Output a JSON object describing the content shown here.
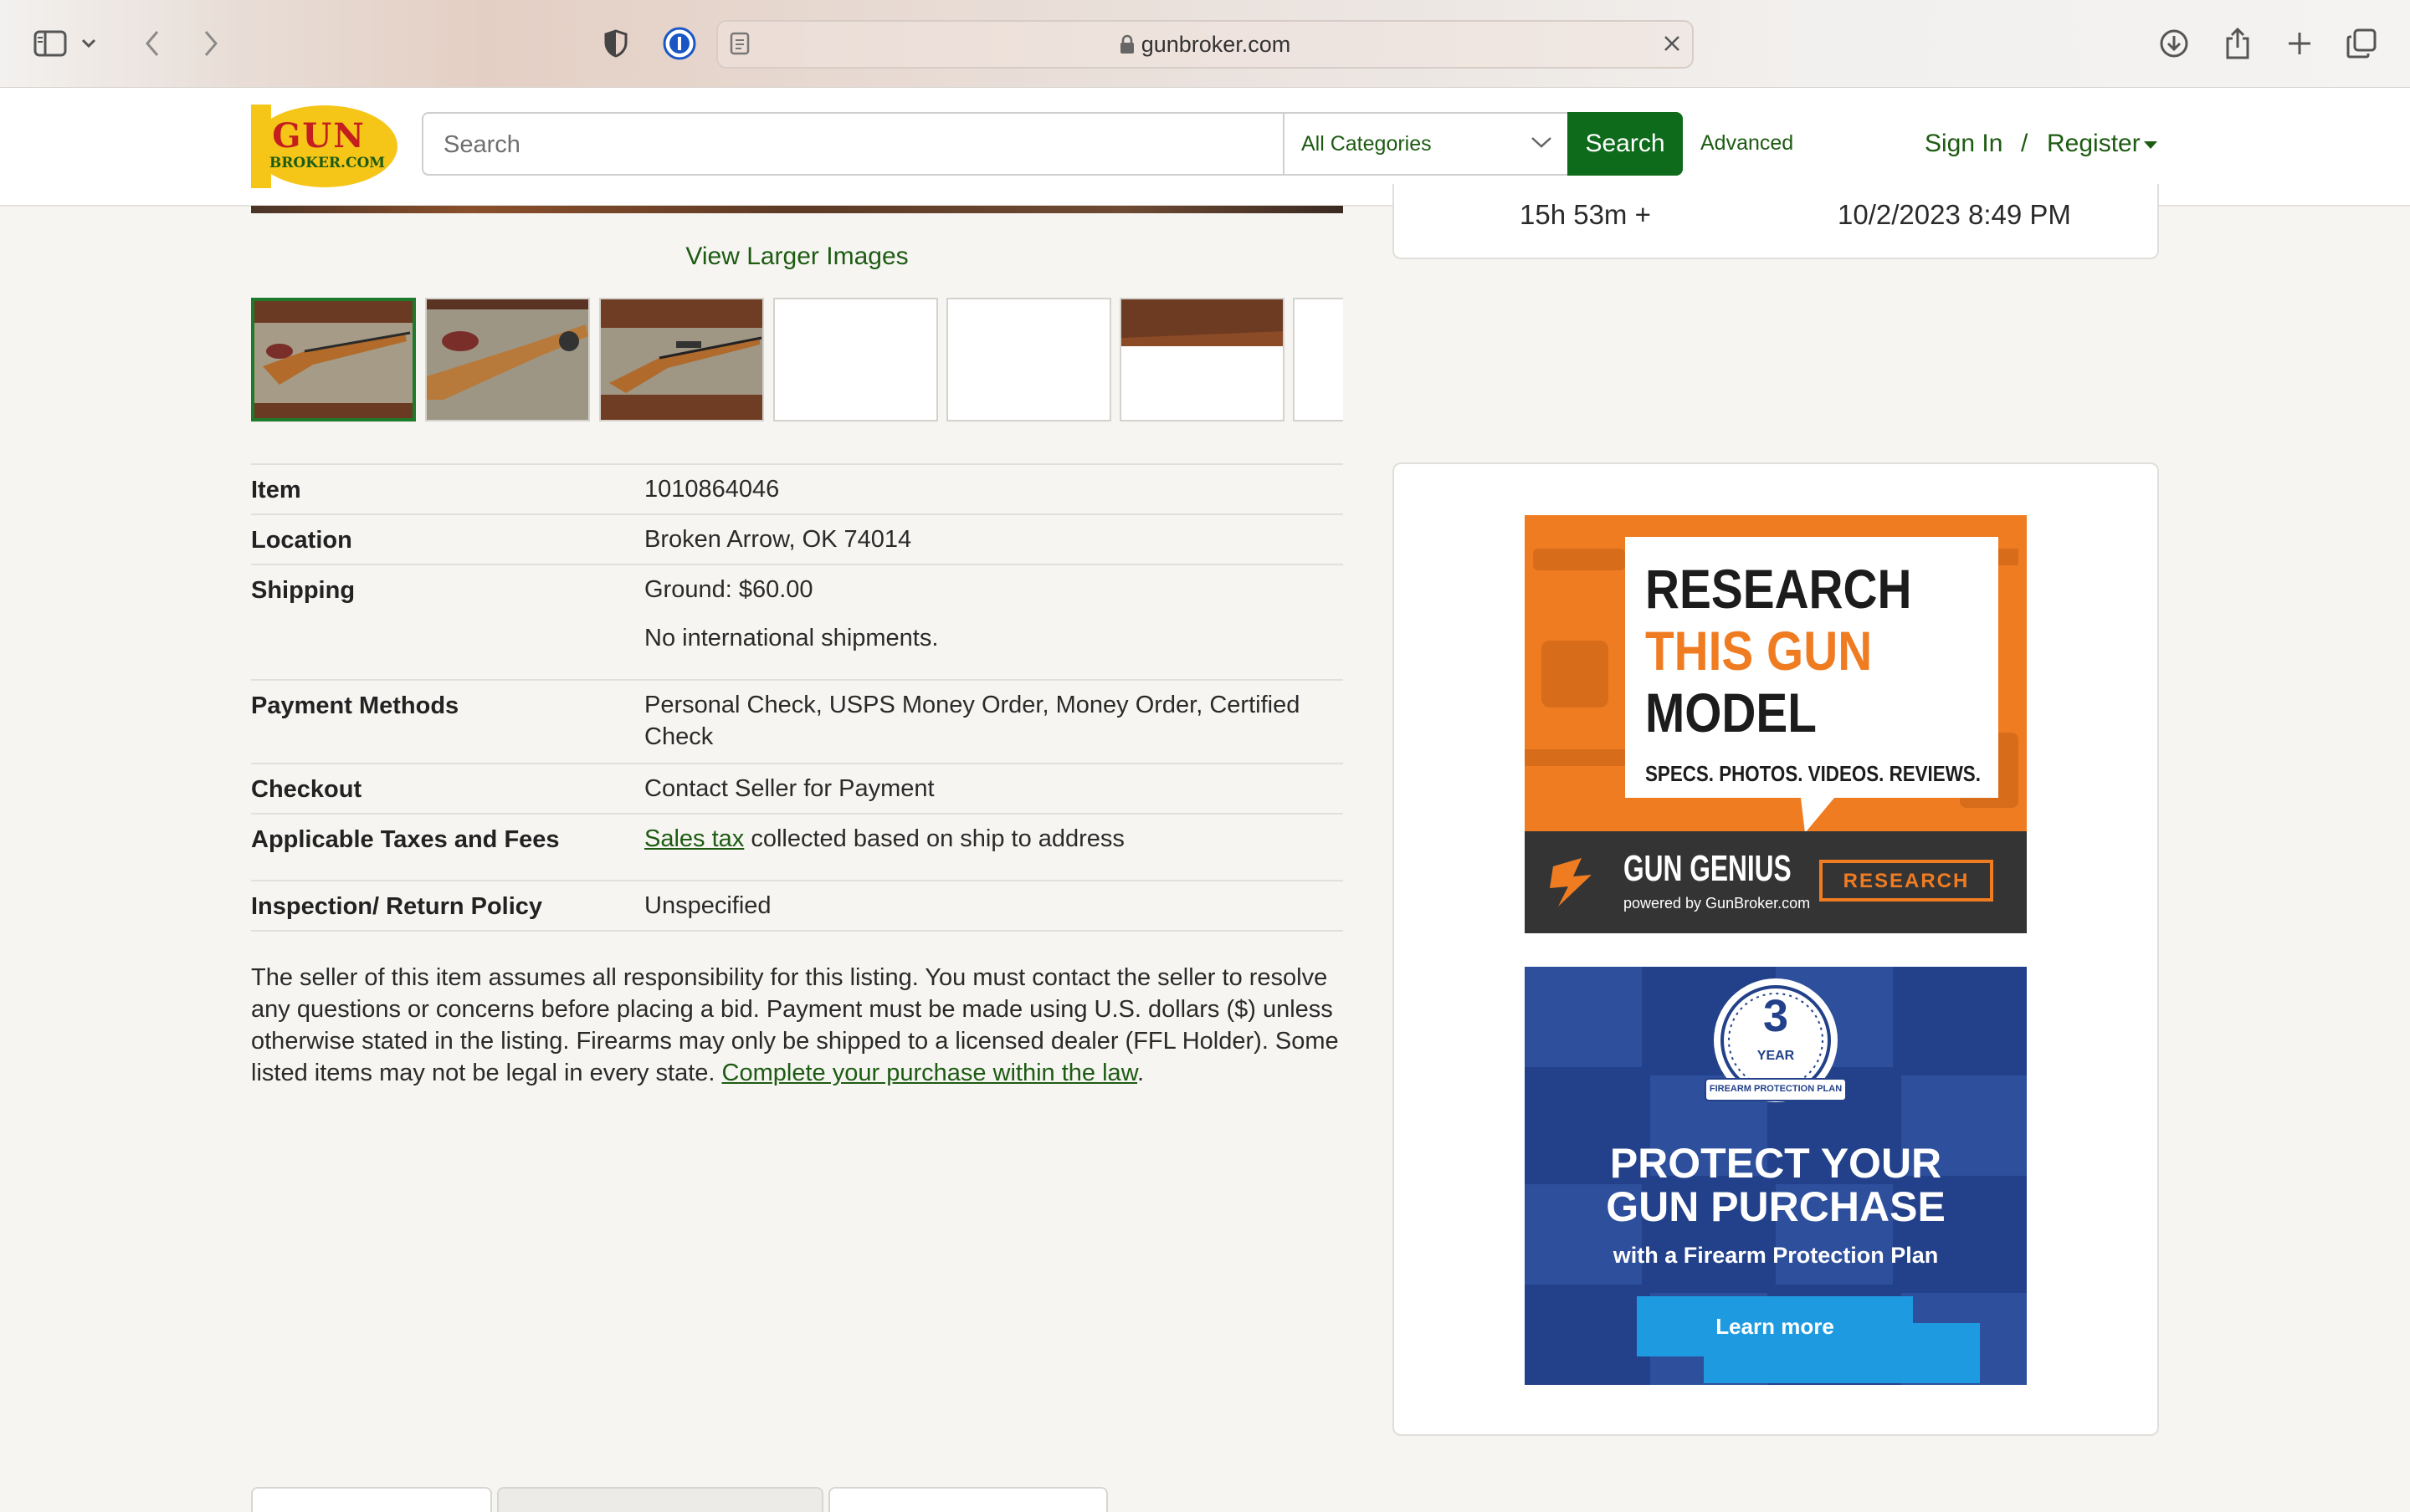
{
  "browser": {
    "url": "gunbroker.com",
    "icons": [
      "sidebar-icon",
      "chevron-down-icon",
      "back-icon",
      "forward-icon",
      "privacy-shield-icon",
      "password-manager-icon",
      "reader-icon",
      "lock-icon",
      "clear-icon",
      "download-icon",
      "share-icon",
      "new-tab-icon",
      "tabs-overview-icon"
    ]
  },
  "header": {
    "logo_line1": "GUN",
    "logo_line2": "BROKER.COM",
    "search_placeholder": "Search",
    "category": "All Categories",
    "search_button": "Search",
    "advanced": "Advanced",
    "sign_in": "Sign In",
    "separator": "/",
    "register": "Register",
    "brand_green": "#0f6b1c",
    "logo_yellow": "#f5c518"
  },
  "gallery": {
    "view_larger": "View Larger Images",
    "thumbnail_count": 7,
    "selected_index": 0
  },
  "auction": {
    "time_left": "15h 53m +",
    "end_time": "10/2/2023 8:49 PM"
  },
  "details": {
    "item_label": "Item",
    "item_value": "1010864046",
    "location_label": "Location",
    "location_value": "Broken Arrow, OK 74014",
    "shipping_label": "Shipping",
    "shipping_value": "Ground: $60.00",
    "shipping_note": "No international shipments.",
    "payment_label": "Payment Methods",
    "payment_value": "Personal Check, USPS Money Order, Money Order, Certified Check",
    "checkout_label": "Checkout",
    "checkout_value": "Contact Seller for Payment",
    "taxes_label": "Applicable Taxes and Fees",
    "taxes_link": "Sales tax",
    "taxes_rest": " collected based on ship to address",
    "inspection_label": "Inspection/ Return Policy",
    "inspection_value": "Unspecified"
  },
  "disclaimer": {
    "text": "The seller of this item assumes all responsibility for this listing. You must contact the seller to resolve any questions or concerns before placing a bid. Payment must be made using U.S. dollars ($) unless otherwise stated in the listing. Firearms may only be shipped to a licensed dealer (FFL Holder). Some listed items may not be legal in every state. ",
    "link": "Complete your purchase within the law",
    "end": "."
  },
  "ads": {
    "research": {
      "line1": "RESEARCH",
      "line2": "THIS GUN",
      "line3": "MODEL",
      "tagline": "SPECS. PHOTOS. VIDEOS. REVIEWS.",
      "brand": "GUN GENIUS",
      "brand_sub": "powered by GunBroker.com",
      "button": "RESEARCH",
      "accent": "#f07c22"
    },
    "protect": {
      "badge_number": "3",
      "badge_year": "YEAR",
      "badge_plan": "FIREARM PROTECTION PLAN",
      "headline1": "PROTECT YOUR",
      "headline2": "GUN PURCHASE",
      "subline": "with a Firearm Protection Plan",
      "button": "Learn more",
      "bg": "#23418a",
      "button_color": "#1e9be0"
    }
  }
}
